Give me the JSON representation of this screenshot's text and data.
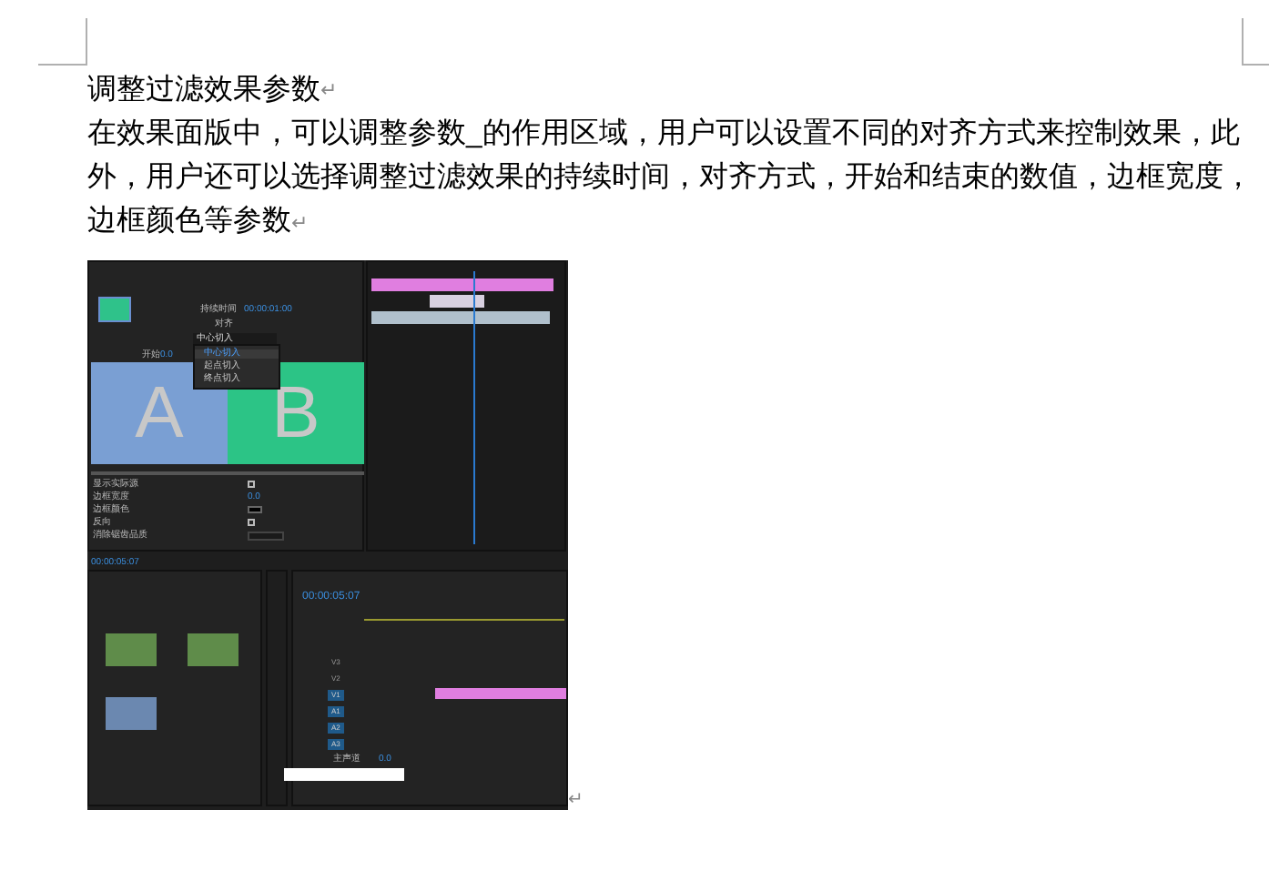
{
  "document": {
    "heading": "调整过滤效果参数",
    "heading_mark": "↵",
    "paragraph": "在效果面版中，可以调整参数_的作用区域，用户可以设置不同的对齐方式来控制效果，此外，用户还可以选择调整过滤效果的持续时间，对齐方式，开始和结束的数值，边框宽度，边框颜色等参数",
    "paragraph_mark": "↵",
    "image_mark": "↵"
  },
  "screenshot": {
    "effect_controls": {
      "duration_label": "持续时间",
      "duration": "00:00:01:00",
      "align_label": "对齐",
      "align_value": "中心切入",
      "menu": [
        {
          "label": "中心切入",
          "selected": true
        },
        {
          "label": "起点切入",
          "selected": false
        },
        {
          "label": "终点切入",
          "selected": false
        }
      ],
      "start_label": "开始",
      "start_value": "0.0",
      "preview_a": "A",
      "preview_b": "B",
      "settings": [
        {
          "label": "显示实际源",
          "kind": "checkbox",
          "checked": false
        },
        {
          "label": "边框宽度",
          "kind": "number",
          "value": "0.0"
        },
        {
          "label": "边框颜色",
          "kind": "color"
        },
        {
          "label": "反向",
          "kind": "checkbox",
          "checked": false
        },
        {
          "label": "消除锯齿品质",
          "kind": "dropdown"
        }
      ],
      "timecode": "00:00:05:07"
    },
    "sequence": {
      "timecode": "00:00:05:07",
      "tracks": [
        {
          "name": "V3",
          "kind": "video",
          "clip": false
        },
        {
          "name": "V2",
          "kind": "video",
          "clip": false
        },
        {
          "name": "V1",
          "kind": "video",
          "clip": true
        },
        {
          "name": "A1",
          "kind": "audio",
          "clip": false
        },
        {
          "name": "A2",
          "kind": "audio",
          "clip": false
        },
        {
          "name": "A3",
          "kind": "audio",
          "clip": false
        }
      ],
      "master_label": "主声道",
      "master_value": "0.0"
    }
  }
}
